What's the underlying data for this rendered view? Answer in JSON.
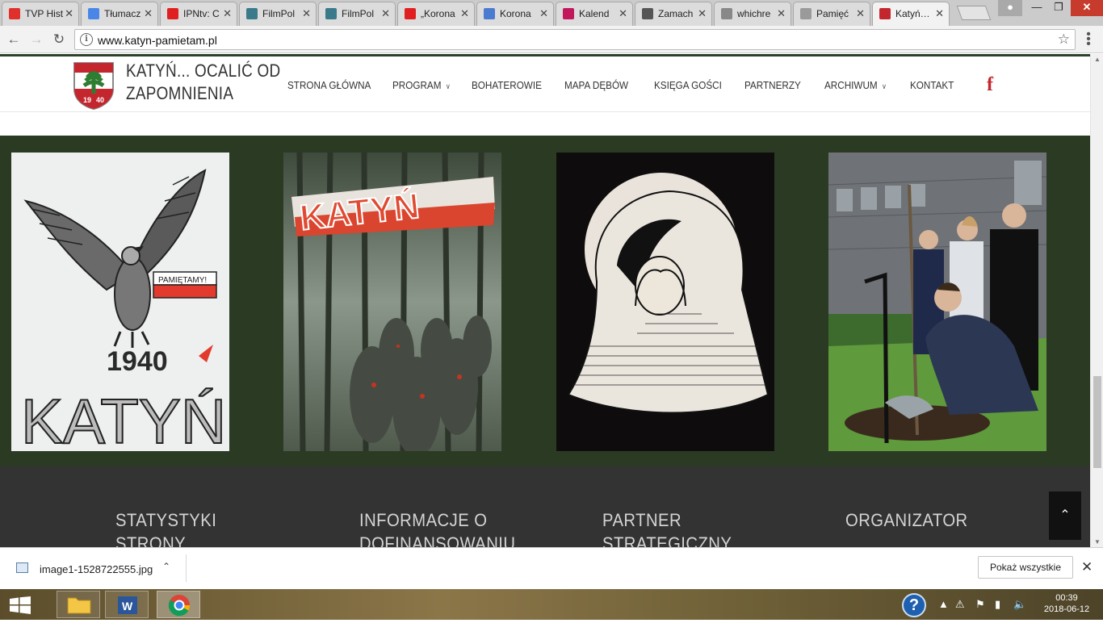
{
  "browser": {
    "tabs": [
      {
        "title": "TVP Hist",
        "icon": "tvp-favicon",
        "color": "#e0302c"
      },
      {
        "title": "Tłumacz",
        "icon": "google-translate-favicon",
        "color": "#4a86e8"
      },
      {
        "title": "IPNtv: C",
        "icon": "youtube-favicon",
        "color": "#e02020"
      },
      {
        "title": "FilmPol",
        "icon": "filmpolski-favicon",
        "color": "#3a7a8a"
      },
      {
        "title": "FilmPol",
        "icon": "filmpolski-favicon",
        "color": "#3a7a8a"
      },
      {
        "title": "„Korona",
        "icon": "youtube-favicon",
        "color": "#e02020"
      },
      {
        "title": "Korona",
        "icon": "site-favicon",
        "color": "#4b7bd1"
      },
      {
        "title": "Kalend",
        "icon": "wp-favicon",
        "color": "#c2185b"
      },
      {
        "title": "Zamach",
        "icon": "wikipedia-favicon",
        "color": "#555555"
      },
      {
        "title": "whichre",
        "icon": "page-favicon",
        "color": "#888888"
      },
      {
        "title": "Pamięć",
        "icon": "emblem-favicon",
        "color": "#9a9a9a"
      },
      {
        "title": "Katyń…",
        "icon": "katyn-favicon",
        "color": "#c4262e",
        "active": true
      }
    ],
    "url": "www.katyn-pamietam.pl"
  },
  "site": {
    "title_line1": "KATYŃ... OCALIĆ OD",
    "title_line2": "ZAPOMNIENIA",
    "logo_year_left": "19",
    "logo_year_right": "40",
    "nav": [
      {
        "label": "STRONA GŁÓWNA",
        "dropdown": false
      },
      {
        "label": "PROGRAM",
        "dropdown": true
      },
      {
        "label": "BOHATEROWIE",
        "dropdown": false
      },
      {
        "label": "MAPA DĘBÓW",
        "dropdown": false
      },
      {
        "label": "KSIĘGA GOŚCI",
        "dropdown": false
      },
      {
        "label": "PARTNERZY",
        "dropdown": false
      },
      {
        "label": "ARCHIWUM",
        "dropdown": true
      },
      {
        "label": "KONTAKT",
        "dropdown": false
      }
    ],
    "facebook_icon": "f",
    "accent_color": "#c4262e",
    "gallery_bg": "#2b3b23",
    "gallery": [
      {
        "name": "eagle-drawing",
        "banner_text": "PAMIĘTAMY!",
        "year": "1940",
        "word": "KATYŃ"
      },
      {
        "name": "forest-painting",
        "word": "KATYŃ"
      },
      {
        "name": "mourning-woman-drawing"
      },
      {
        "name": "tree-planting-photo"
      }
    ],
    "footer": [
      {
        "title": "STATYSTYKI STRONY"
      },
      {
        "title": "INFORMACJE O DOFINANSOWANIU"
      },
      {
        "title": "PARTNER STRATEGICZNY"
      },
      {
        "title": "ORGANIZATOR"
      }
    ]
  },
  "downloads": {
    "file": "image1-1528722555.jpg",
    "show_all": "Pokaż wszystkie"
  },
  "taskbar": {
    "time": "00:39",
    "date": "2018-06-12"
  }
}
